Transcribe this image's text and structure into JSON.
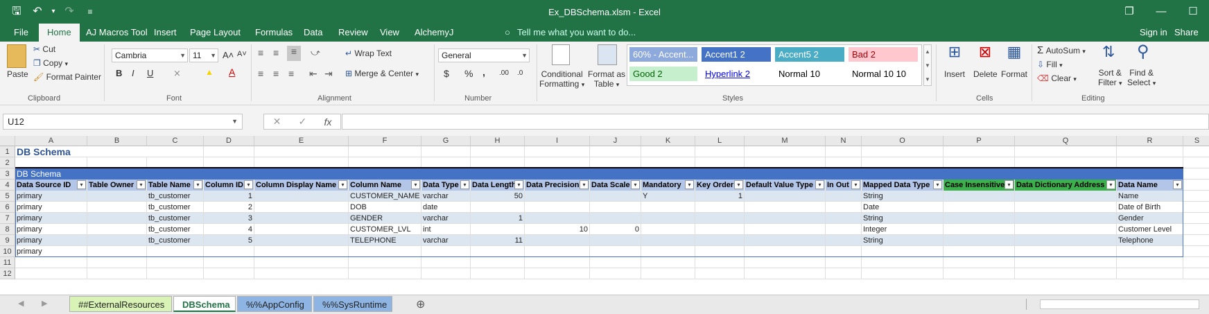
{
  "window": {
    "title": "Ex_DBSchema.xlsm - Excel"
  },
  "qat": {
    "save": "🖫",
    "undo": "↶",
    "undo_drop": "▾",
    "redo": "↷",
    "more": "≡"
  },
  "winctl": {
    "restore": "❐",
    "minimize": "—",
    "maximize": "☐"
  },
  "tabs": [
    "File",
    "Home",
    "AJ Macros Tool",
    "Insert",
    "Page Layout",
    "Formulas",
    "Data",
    "Review",
    "View",
    "AlchemyJ"
  ],
  "tell_me": "Tell me what you want to do...",
  "signin": "Sign in",
  "share": "Share",
  "clipboard": {
    "paste": "Paste",
    "cut": "Cut",
    "copy": "Copy",
    "format_painter": "Format Painter",
    "label": "Clipboard"
  },
  "font": {
    "name": "Cambria",
    "size": "11",
    "grow": "A˄",
    "shrink": "A˅",
    "bold": "B",
    "italic": "I",
    "underline": "U",
    "borders": "⨯",
    "fill": "▲",
    "color": "A",
    "label": "Font"
  },
  "alignment": {
    "wrap": "Wrap Text",
    "merge": "Merge & Center",
    "label": "Alignment"
  },
  "number": {
    "format": "General",
    "currency": "$",
    "percent": "%",
    "comma": ",",
    "inc": ".00",
    "dec": ".0",
    "label": "Number"
  },
  "styles": {
    "conditional": [
      "Conditional",
      "Formatting"
    ],
    "format_as": [
      "Format as",
      "Table"
    ],
    "cells": [
      "60% - Accent...",
      "Accent1 2",
      "Accent5 2",
      "Bad 2",
      "Good 2",
      "Hyperlink 2",
      "Normal 10",
      "Normal 10 10"
    ],
    "label": "Styles"
  },
  "cells_group": {
    "insert": "Insert",
    "delete": "Delete",
    "format": "Format",
    "label": "Cells"
  },
  "editing": {
    "autosum": "AutoSum",
    "fill": "Fill",
    "clear": "Clear",
    "sort": [
      "Sort &",
      "Filter"
    ],
    "find": [
      "Find &",
      "Select"
    ],
    "label": "Editing"
  },
  "namebox": "U12",
  "fx": "fx",
  "columns": [
    "A",
    "B",
    "C",
    "D",
    "E",
    "F",
    "G",
    "H",
    "I",
    "J",
    "K",
    "L",
    "M",
    "N",
    "O",
    "P",
    "Q",
    "R",
    "S"
  ],
  "rows": [
    "1",
    "2",
    "3",
    "4",
    "5",
    "6",
    "7",
    "8",
    "9",
    "10",
    "11",
    "12"
  ],
  "sheet": {
    "title": "DB Schema",
    "section": "DB Schema",
    "headers": [
      "Data Source ID",
      "Table Owner",
      "Table Name",
      "Column ID",
      "Column Display Name",
      "Column Name",
      "Data Type",
      "Data Length",
      "Data Precision",
      "Data Scale",
      "Mandatory",
      "Key Order",
      "Default Value Type",
      "In Out",
      "Mapped Data Type",
      "Case Insensitive",
      "Data Dictionary Address",
      "Data Name"
    ],
    "data": [
      [
        "primary",
        "",
        "tb_customer",
        "1",
        "",
        "CUSTOMER_NAME",
        "varchar",
        "50",
        "",
        "",
        "Y",
        "1",
        "",
        "",
        "String",
        "",
        "",
        "Name"
      ],
      [
        "primary",
        "",
        "tb_customer",
        "2",
        "",
        "DOB",
        "date",
        "",
        "",
        "",
        "",
        "",
        "",
        "",
        "Date",
        "",
        "",
        "Date of Birth"
      ],
      [
        "primary",
        "",
        "tb_customer",
        "3",
        "",
        "GENDER",
        "varchar",
        "1",
        "",
        "",
        "",
        "",
        "",
        "",
        "String",
        "",
        "",
        "Gender"
      ],
      [
        "primary",
        "",
        "tb_customer",
        "4",
        "",
        "CUSTOMER_LVL",
        "int",
        "",
        "10",
        "0",
        "",
        "",
        "",
        "",
        "Integer",
        "",
        "",
        "Customer Level"
      ],
      [
        "primary",
        "",
        "tb_customer",
        "5",
        "",
        "TELEPHONE",
        "varchar",
        "11",
        "",
        "",
        "",
        "",
        "",
        "",
        "String",
        "",
        "",
        "Telephone"
      ],
      [
        "primary",
        "",
        "",
        "",
        "",
        "",
        "",
        "",
        "",
        "",
        "",
        "",
        "",
        "",
        "",
        "",
        "",
        ""
      ]
    ]
  },
  "sheettabs": [
    "##ExternalResources",
    "DBSchema",
    "%%AppConfig",
    "%%SysRuntime"
  ],
  "addsheet": "⊕",
  "colors": {
    "excel_green": "#217346",
    "header_blue": "#b4c6e7",
    "section_blue": "#4472c4",
    "band": "#dce6f1",
    "green_hdr": "#3cb04a"
  }
}
